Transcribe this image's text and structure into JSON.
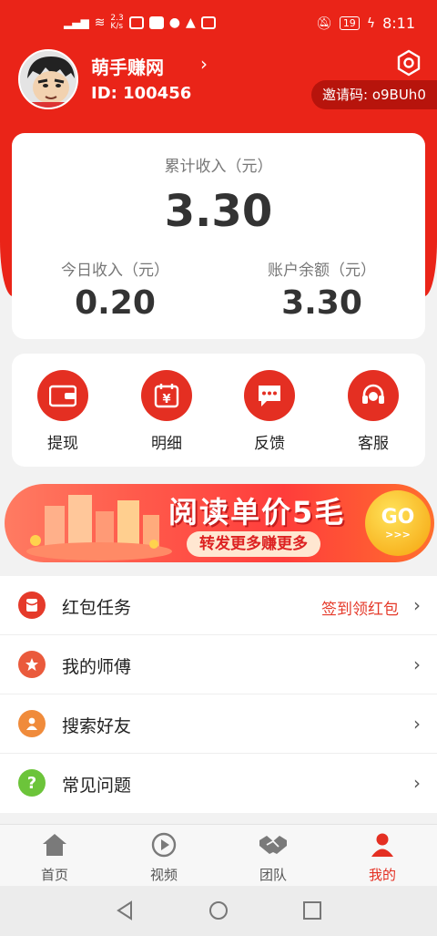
{
  "status_bar": {
    "net_speed": "2.3\nK/s",
    "battery": "19",
    "time": "8:11"
  },
  "profile": {
    "name": "萌手赚网",
    "id_text": "ID: 100456",
    "invite": "邀请码: o9BUh0"
  },
  "earnings": {
    "total_label": "累计收入（元）",
    "total_value": "3.30",
    "today_label": "今日收入（元）",
    "today_value": "0.20",
    "balance_label": "账户余额（元）",
    "balance_value": "3.30"
  },
  "quick_actions": [
    {
      "label": "提现",
      "icon": "wallet-icon"
    },
    {
      "label": "明细",
      "icon": "calendar-yen-icon"
    },
    {
      "label": "反馈",
      "icon": "chat-bubble-icon"
    },
    {
      "label": "客服",
      "icon": "headset-icon"
    }
  ],
  "banner": {
    "title": "阅读单价5毛",
    "subtitle": "转发更多赚更多",
    "go": "GO",
    "arrows": ">>>"
  },
  "menu": [
    {
      "label": "红包任务",
      "extra": "签到领红包",
      "icon": "red-envelope-icon",
      "color": "#e53a2a"
    },
    {
      "label": "我的师傅",
      "extra": "",
      "icon": "star-icon",
      "color": "#ea5a3c"
    },
    {
      "label": "搜索好友",
      "extra": "",
      "icon": "person-icon",
      "color": "#f08b3b"
    },
    {
      "label": "常见问题",
      "extra": "",
      "icon": "question-icon",
      "color": "#6cc43a"
    }
  ],
  "tabs": [
    {
      "label": "首页",
      "icon": "home-icon"
    },
    {
      "label": "视频",
      "icon": "play-icon"
    },
    {
      "label": "团队",
      "icon": "handshake-icon"
    },
    {
      "label": "我的",
      "icon": "person-icon",
      "active": true
    }
  ],
  "colors": {
    "brand_red": "#ea2418",
    "accent": "#e42f22"
  }
}
